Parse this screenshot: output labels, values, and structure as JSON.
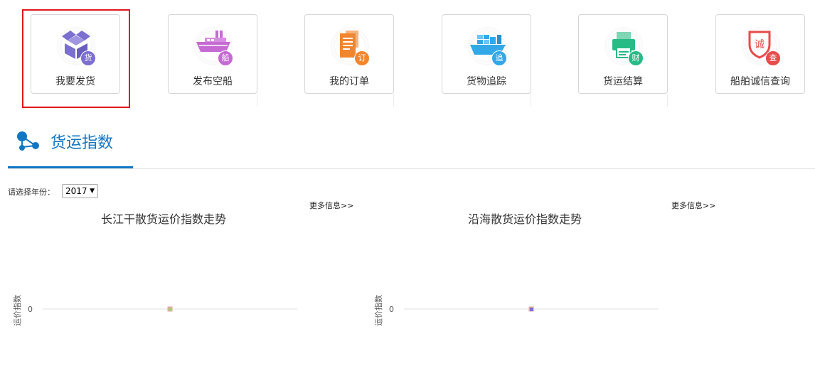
{
  "tiles": [
    {
      "label": "我要发货",
      "badge": "货",
      "color": "#7b6fcf",
      "icon": "box-icon"
    },
    {
      "label": "发布空船",
      "badge": "船",
      "color": "#c56ad2",
      "icon": "ship-icon"
    },
    {
      "label": "我的订单",
      "badge": "订",
      "color": "#f2862f",
      "icon": "document-icon"
    },
    {
      "label": "货物追踪",
      "badge": "追",
      "color": "#33a8e8",
      "icon": "cargo-ship-icon"
    },
    {
      "label": "货运结算",
      "badge": "财",
      "color": "#27bb86",
      "icon": "printer-icon"
    },
    {
      "label": "船舶诚信查询",
      "badge": "查",
      "color": "#e94a4a",
      "icon": "shield-search-icon"
    }
  ],
  "section": {
    "title": "货运指数"
  },
  "filter": {
    "label": "请选择年份：",
    "year": "2017"
  },
  "more_link": "更多信息>>",
  "chart_data": [
    {
      "type": "line",
      "title": "长江干散货运价指数走势",
      "ylabel": "运价指数",
      "yticks": [
        0
      ],
      "series": [
        {
          "values": [
            0
          ]
        }
      ],
      "marker_colors": [
        "#e7a9a0",
        "#9fd37a"
      ]
    },
    {
      "type": "line",
      "title": "沿海散货运价指数走势",
      "ylabel": "运价指数",
      "yticks": [
        0
      ],
      "series": [
        {
          "values": [
            0
          ]
        }
      ],
      "marker_colors": [
        "#e7a9a0",
        "#6f6fd0"
      ]
    }
  ]
}
